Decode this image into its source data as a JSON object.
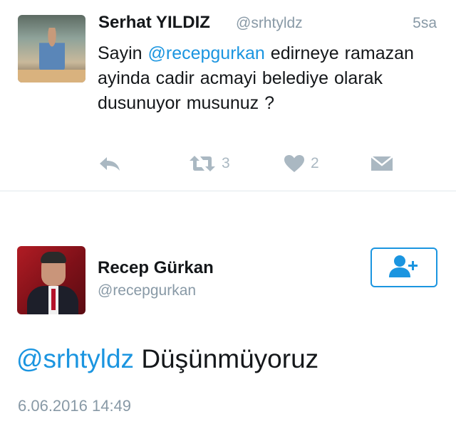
{
  "tweet": {
    "author_name": "Serhat YILDIZ",
    "author_handle": "@srhtyldz",
    "time": "5sa",
    "text_before": "Sayin ",
    "mention": "@recepgurkan",
    "text_after": " edirneye ramazan ayinda cadir acmayi belediye olarak dusunuyor musunuz ?",
    "actions": {
      "reply_icon": "reply-icon",
      "retweet_icon": "retweet-icon",
      "retweet_count": "3",
      "like_icon": "heart-icon",
      "like_count": "2",
      "dm_icon": "envelope-icon"
    }
  },
  "reply_tweet": {
    "author_name": "Recep Gürkan",
    "author_handle": "@recepgurkan",
    "follow_icon": "follow-user-icon",
    "mention": "@srhtyldz",
    "text": " Düşünmüyoruz",
    "timestamp": "6.06.2016 14:49"
  },
  "colors": {
    "accent": "#1b95e0",
    "muted": "#8899a6",
    "action_gray": "#aab8c2",
    "text": "#14171a",
    "divider": "#e1e8ed"
  }
}
